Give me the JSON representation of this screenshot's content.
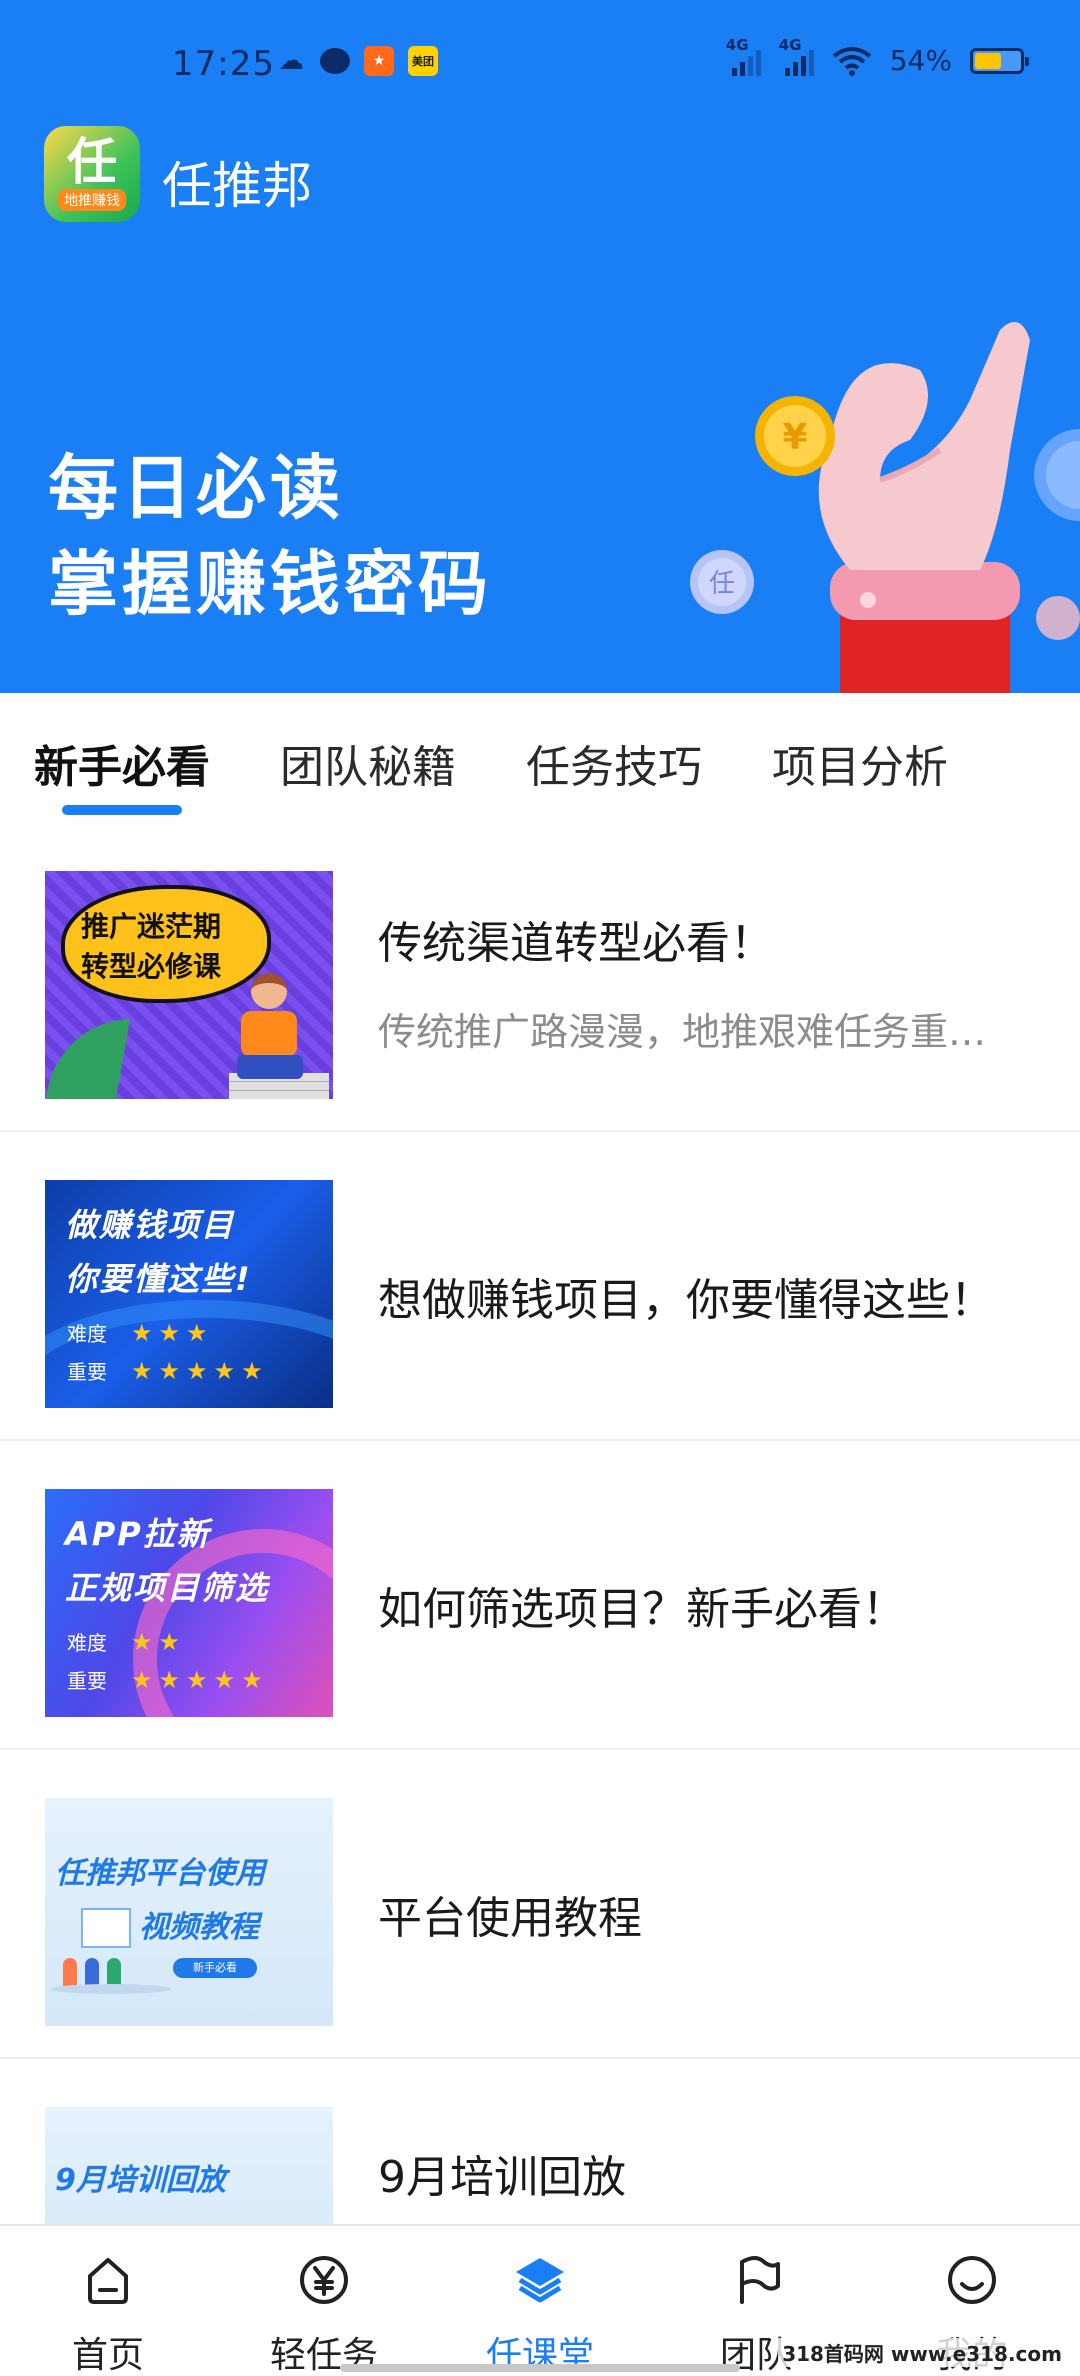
{
  "status_bar": {
    "time": "17:25",
    "app_icons": [
      "cloud-icon",
      "chat-icon",
      "orange-app-icon",
      "meituan-icon"
    ],
    "meituan_label": "美团",
    "sim1": "4G",
    "sim2": "4G",
    "battery": "54%"
  },
  "app": {
    "logo_char": "任",
    "logo_sub": "地推赚钱",
    "title": "任推邦"
  },
  "banner": {
    "line1": "每日必读",
    "line2": "掌握赚钱密码",
    "coin_symbol": "¥",
    "coin_small": "任"
  },
  "tabs": [
    {
      "label": "新手必看",
      "active": true
    },
    {
      "label": "团队秘籍",
      "active": false
    },
    {
      "label": "任务技巧",
      "active": false
    },
    {
      "label": "项目分析",
      "active": false
    }
  ],
  "articles": [
    {
      "title": "传统渠道转型必看！",
      "desc": "传统推广路漫漫，地推艰难任务重…",
      "thumb": {
        "line1": "推广迷茫期",
        "line2": "转型必修课"
      }
    },
    {
      "title": "想做赚钱项目，你要懂得这些！",
      "thumb": {
        "line1": "做赚钱项目",
        "line2": "你要懂这些!",
        "difficulty_label": "难度",
        "importance_label": "重要",
        "difficulty_stars": 3,
        "importance_stars": 5
      }
    },
    {
      "title": "如何筛选项目？新手必看！",
      "thumb": {
        "line1": "APP拉新",
        "line2": "正规项目筛选",
        "difficulty_label": "难度",
        "importance_label": "重要",
        "difficulty_stars": 2,
        "importance_stars": 5
      }
    },
    {
      "title": "平台使用教程",
      "thumb": {
        "line1": "任推邦平台使用",
        "line2": "视频教程",
        "badge": "新手必看"
      }
    },
    {
      "title": "9月培训回放",
      "thumb": {
        "line1": "9月培训回放",
        "line2": "..."
      }
    }
  ],
  "bottom_nav": [
    {
      "label": "首页",
      "icon": "home-icon",
      "active": false
    },
    {
      "label": "轻任务",
      "icon": "yuan-coin-icon",
      "active": false
    },
    {
      "label": "任课堂",
      "icon": "layers-icon",
      "active": true
    },
    {
      "label": "团队",
      "icon": "flag-icon",
      "active": false
    },
    {
      "label": "我的",
      "icon": "smile-icon",
      "active": false
    }
  ],
  "watermark": "318首码网 www.e318.com",
  "colors": {
    "primary": "#1a7ff5",
    "text": "#1a1a1a",
    "muted": "#8c8c8c",
    "star": "#ffc61a"
  }
}
